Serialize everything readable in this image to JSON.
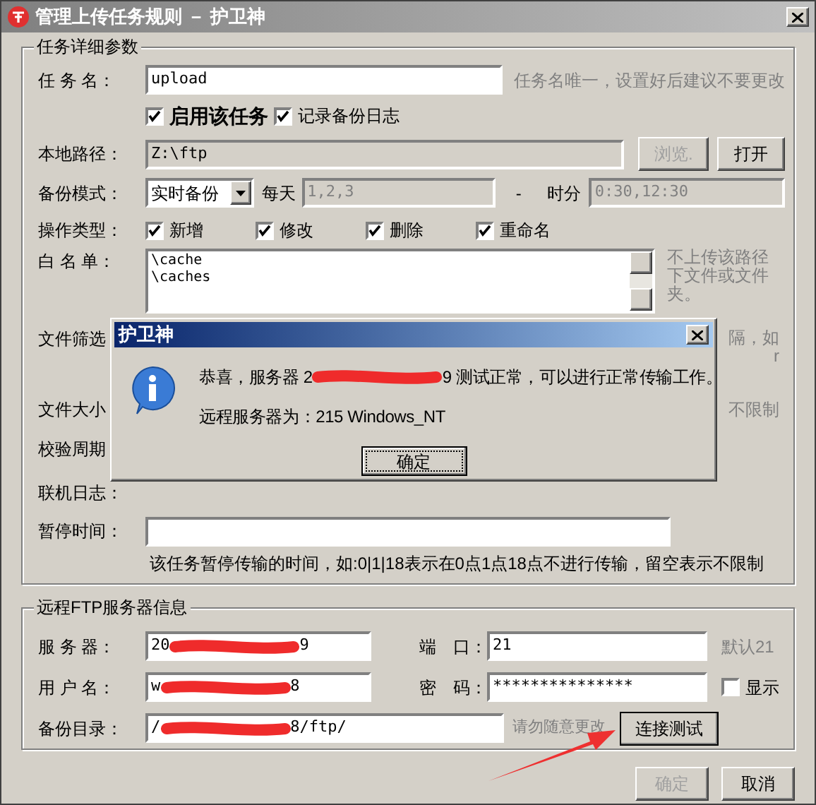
{
  "window": {
    "title": "管理上传任务规则 － 护卫神"
  },
  "task_group": {
    "title": "任务详细参数",
    "task_name": {
      "label": "任 务 名：",
      "value": "upload",
      "hint": "任务名唯一，设置好后建议不要更改"
    },
    "flags": [
      {
        "label": "启用该任务",
        "checked": true,
        "bold": true
      },
      {
        "label": "记录备份日志",
        "checked": true,
        "bold": false
      }
    ],
    "local_path": {
      "label": "本地路径：",
      "value": "Z:\\ftp",
      "browse": "浏览.",
      "browse_disabled": true,
      "open": "打开"
    },
    "backup_mode": {
      "label": "备份模式：",
      "value": "实时备份",
      "days_label": "每天",
      "days": "1,2,3",
      "dash": "-",
      "time_label": "时分",
      "time": "0:30,12:30"
    },
    "operations": {
      "label": "操作类型：",
      "items": [
        {
          "label": "新增",
          "checked": true
        },
        {
          "label": "修改",
          "checked": true
        },
        {
          "label": "删除",
          "checked": true
        },
        {
          "label": "重命名",
          "checked": true
        }
      ]
    },
    "whitelist": {
      "label": "白 名 单：",
      "lines": [
        "\\cache",
        "\\caches"
      ],
      "hint": "不上传该路径下文件或文件夹。"
    },
    "filter": {
      "label": "文件筛选",
      "hint": "隔，如",
      "hint2": "r"
    },
    "size": {
      "label": "文件大小",
      "hint": "不限制"
    },
    "verify": {
      "label": "校验周期"
    },
    "online_log": {
      "label": "联机日志："
    },
    "pause": {
      "label": "暂停时间：",
      "hint": "该任务暂停传输的时间，如:0|1|18表示在0点1点18点不进行传输，留空表示不限制"
    }
  },
  "ftp_group": {
    "title": "远程FTP服务器信息",
    "server": {
      "label": "服 务 器：",
      "value_start": "20",
      "value_end": "9"
    },
    "port": {
      "label": "端　口：",
      "value": "21",
      "hint": "默认21"
    },
    "user": {
      "label": "用 户 名：",
      "value_start": "w",
      "value_end": "8"
    },
    "password": {
      "label": "密　码：",
      "value": "***************",
      "show_label": "显示",
      "show_checked": false
    },
    "dir": {
      "label": "备份目录：",
      "value_start": "/",
      "value_end": "8/ftp/",
      "hint": "请勿随意更改",
      "test": "连接测试"
    }
  },
  "buttons": [
    {
      "label": "确定",
      "disabled": true
    },
    {
      "label": "取消",
      "disabled": false
    }
  ],
  "dialog": {
    "title": "护卫神",
    "message_start": "恭喜，服务器 2",
    "message_end": "9 测试正常，可以进行正常传输工作。",
    "server_info": "远程服务器为：215 Windows_NT",
    "ok": "确定"
  }
}
